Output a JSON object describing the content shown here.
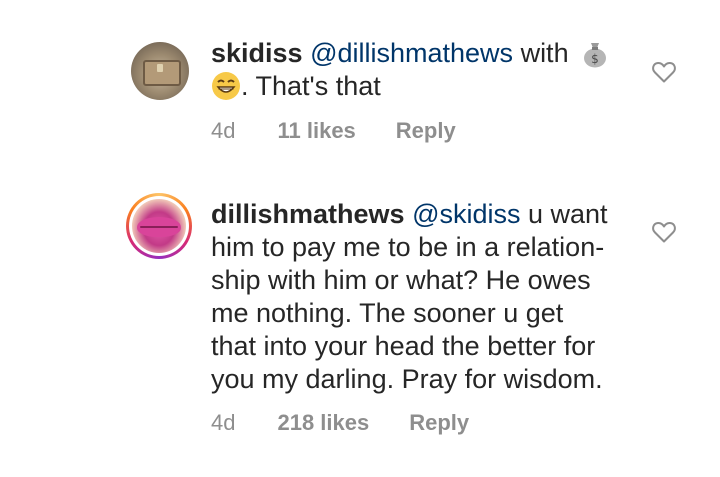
{
  "comments": [
    {
      "username": "skidiss",
      "mention": "@dillishmathews",
      "text_line1_after_mention": " with",
      "emoji1": "money-bag-emoji",
      "emoji2": "grinning-emoji",
      "text_line2": ". That's that",
      "age": "4d",
      "likes": "11 likes",
      "reply": "Reply"
    },
    {
      "username": "dillishmathews",
      "mention": "@skidiss",
      "text_line1_after_mention": " u want",
      "text_rest": [
        "him to pay me to be in a relation-",
        "ship with him or what? He owes",
        "me nothing. The sooner u get",
        "that into your head the better for",
        "you my darling. Pray for wisdom."
      ],
      "age": "4d",
      "likes": "218 likes",
      "reply": "Reply"
    }
  ],
  "colors": {
    "text": "#262626",
    "mention": "#003569",
    "meta": "#8e8e8e",
    "story_ring": [
      "#fdc468",
      "#fa7e1e",
      "#d62976",
      "#962fbf"
    ]
  },
  "icons": {
    "like": "heart-outline-icon"
  }
}
